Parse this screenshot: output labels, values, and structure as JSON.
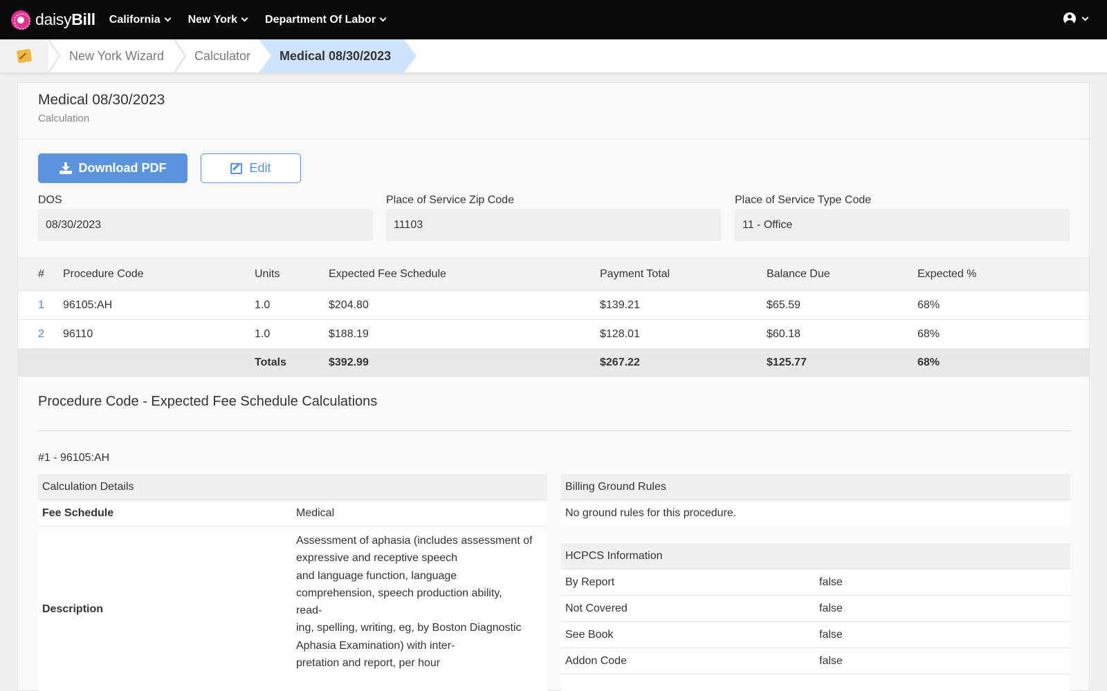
{
  "brand": {
    "name_light": "daisy",
    "name_bold": "Bill"
  },
  "nav": {
    "items": [
      "California",
      "New York",
      "Department Of Labor"
    ]
  },
  "breadcrumb": {
    "items": [
      "New York Wizard",
      "Calculator",
      "Medical 08/30/2023"
    ]
  },
  "page": {
    "title": "Medical 08/30/2023",
    "subtitle": "Calculation"
  },
  "actions": {
    "download_label": "Download PDF",
    "edit_label": "Edit"
  },
  "fields": {
    "dos": {
      "label": "DOS",
      "value": "08/30/2023"
    },
    "zip": {
      "label": "Place of Service Zip Code",
      "value": "11103"
    },
    "type": {
      "label": "Place of Service Type Code",
      "value": "11 - Office"
    }
  },
  "table": {
    "headers": [
      "#",
      "Procedure Code",
      "Units",
      "Expected Fee Schedule",
      "Payment Total",
      "Balance Due",
      "Expected %"
    ],
    "rows": [
      [
        "1",
        "96105:AH",
        "1.0",
        "$204.80",
        "$139.21",
        "$65.59",
        "68%"
      ],
      [
        "2",
        "96110",
        "1.0",
        "$188.19",
        "$128.01",
        "$60.18",
        "68%"
      ]
    ],
    "totals": {
      "label": "Totals",
      "fee": "$392.99",
      "payment": "$267.22",
      "balance": "$125.77",
      "pct": "68%"
    }
  },
  "calc": {
    "section_title": "Procedure Code - Expected Fee Schedule Calculations",
    "item_title": "#1 - 96105:AH",
    "details": {
      "header": "Calculation Details",
      "fee_schedule_label": "Fee Schedule",
      "fee_schedule_value": "Medical",
      "description_label": "Description",
      "description_lines": [
        "Assessment of aphasia (includes assessment of",
        "expressive and receptive speech",
        "and language function, language",
        "comprehension, speech production ability,",
        "read-",
        "ing, spelling, writing, eg, by Boston Diagnostic",
        "Aphasia Examination) with inter-",
        "pretation and report, per hour"
      ]
    },
    "ground_rules": {
      "header": "Billing Ground Rules",
      "text": "No ground rules for this procedure."
    },
    "hcpcs": {
      "header": "HCPCS Information",
      "rows": [
        {
          "label": "By Report",
          "value": "false"
        },
        {
          "label": "Not Covered",
          "value": "false"
        },
        {
          "label": "See Book",
          "value": "false"
        },
        {
          "label": "Addon Code",
          "value": "false"
        }
      ]
    }
  }
}
